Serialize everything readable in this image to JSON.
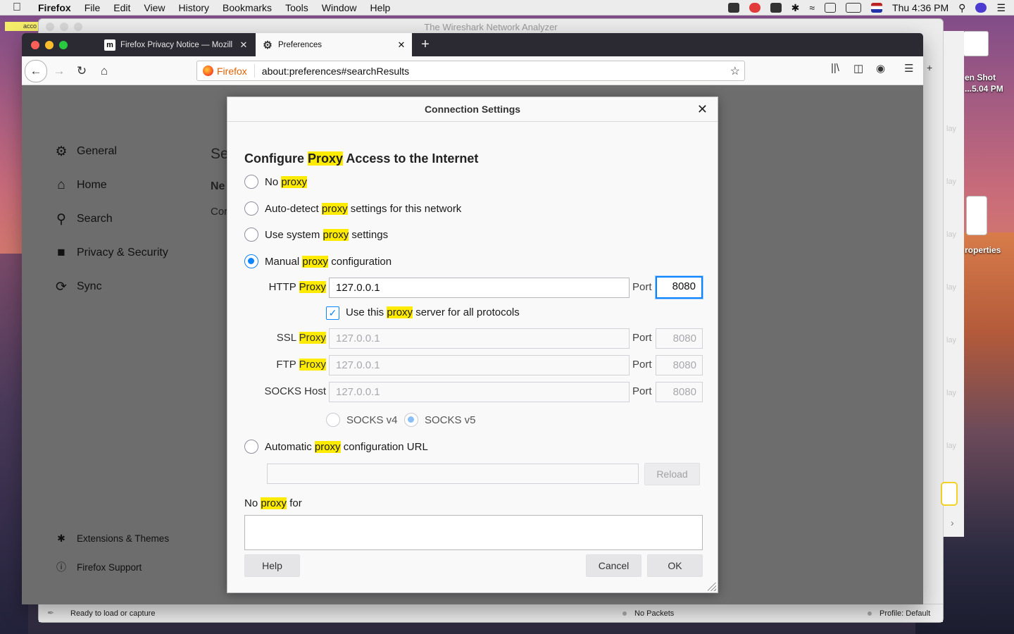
{
  "menubar": {
    "app": "Firefox",
    "items": [
      "File",
      "Edit",
      "View",
      "History",
      "Bookmarks",
      "Tools",
      "Window",
      "Help"
    ],
    "clock": "Thu 4:36 PM"
  },
  "background_window": {
    "title": "The Wireshark Network Analyzer",
    "sticky_text": "acco",
    "status_left": "Ready to load or capture",
    "status_mid": "No Packets",
    "status_right": "Profile: Default"
  },
  "desktop": {
    "screenshot_label_1": "en Shot",
    "screenshot_label_2": "...5.04 PM",
    "properties_label": "roperties",
    "finder_side_text": "lay"
  },
  "browser": {
    "tabs": [
      {
        "title": "Firefox Privacy Notice — Mozill",
        "favicon": "m"
      },
      {
        "title": "Preferences"
      }
    ],
    "identity": "Firefox",
    "url": "about:preferences#searchResults"
  },
  "prefs_nav": {
    "items": [
      "General",
      "Home",
      "Search",
      "Privacy & Security",
      "Sync"
    ],
    "footer": [
      "Extensions & Themes",
      "Firefox Support"
    ],
    "peek_1": "Se",
    "peek_2": "Ne",
    "peek_3": "Cor"
  },
  "dialog": {
    "title": "Connection Settings",
    "heading_pre": "Configure ",
    "heading_hl": "Proxy",
    "heading_post": " Access to the Internet",
    "hl_word": "proxy",
    "hl_word_cap": "Proxy",
    "options": {
      "no_proxy_pre": "No ",
      "auto_detect_pre": "Auto-detect ",
      "auto_detect_post": " settings for this network",
      "system_pre": "Use system ",
      "system_post": " settings",
      "manual_pre": "Manual ",
      "manual_post": " configuration",
      "auto_url_pre": "Automatic ",
      "auto_url_post": " configuration URL"
    },
    "http_label_pre": "HTTP ",
    "http_value": "127.0.0.1",
    "http_port": "8080",
    "port_label": "Port",
    "use_all_pre": "Use this ",
    "use_all_post": " server for all protocols",
    "ssl_label_pre": "SSL ",
    "ssl_value": "127.0.0.1",
    "ssl_port": "8080",
    "ftp_label_pre": "FTP ",
    "ftp_value": "127.0.0.1",
    "ftp_port": "8080",
    "socks_label": "SOCKS Host",
    "socks_value": "127.0.0.1",
    "socks_port": "8080",
    "socks_v4": "SOCKS v4",
    "socks_v5": "SOCKS v5",
    "auto_url_value": "",
    "reload": "Reload",
    "no_proxy_for_pre": "No ",
    "no_proxy_for_post": " for",
    "no_proxy_for_value": "",
    "help": "Help",
    "cancel": "Cancel",
    "ok": "OK",
    "selected_option": "manual",
    "use_all_checked": true
  },
  "colors": {
    "accent": "#0a84ff",
    "highlight": "#ffeb00"
  }
}
